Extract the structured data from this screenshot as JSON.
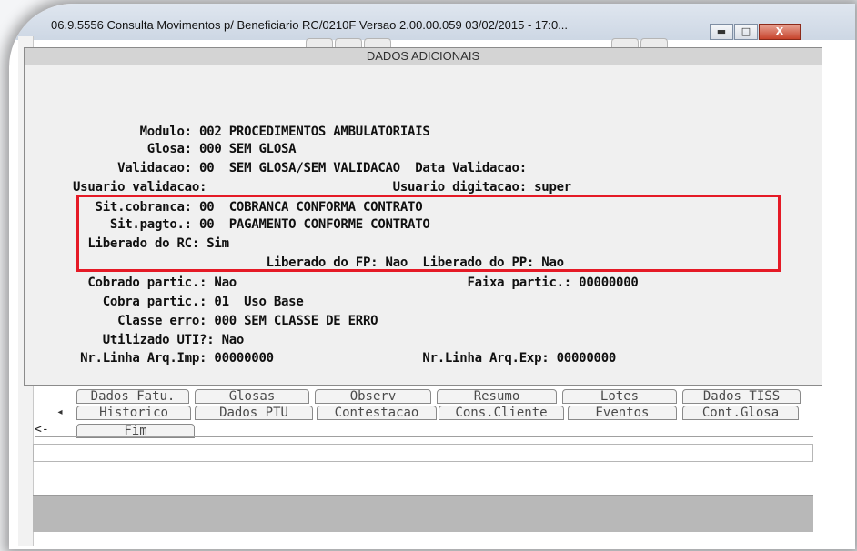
{
  "window": {
    "title": "06.9.5556 Consulta Movimentos p/ Beneficiario RC/0210F Versao 2.00.00.059 03/02/2015 - 17:0...",
    "minimize_glyph": "▬",
    "maximize_glyph": "□",
    "close_glyph": "X"
  },
  "dialog": {
    "title": "DADOS ADICIONAIS",
    "lines": [
      "         Modulo: 002 PROCEDIMENTOS AMBULATORIAIS",
      "          Glosa: 000 SEM GLOSA",
      "      Validacao: 00  SEM GLOSA/SEM VALIDACAO  Data Validacao:",
      "Usuario validacao:                         Usuario digitacao: super",
      "   Sit.cobranca: 00  COBRANCA CONFORMA CONTRATO",
      "     Sit.pagto.: 00  PAGAMENTO CONFORME CONTRATO",
      "  Liberado do RC: Sim",
      "                          Liberado do FP: Nao  Liberado do PP: Nao",
      "  Cobrado partic.: Nao                               Faixa partic.: 00000000",
      "    Cobra partic.: 01  Uso Base",
      "      Classe erro: 000 SEM CLASSE DE ERRO",
      "    Utilizado UTI?: Nao",
      " Nr.Linha Arq.Imp: 00000000                    Nr.Linha Arq.Exp: 00000000"
    ]
  },
  "tabs": {
    "row1": [
      "Dados Fatu.",
      "Glosas",
      "Observ",
      "Resumo",
      "Lotes",
      "Dados TISS"
    ],
    "row2": [
      "Historico",
      "Dados PTU",
      "Contestacao",
      "Cons.Cliente",
      "Eventos",
      "Cont.Glosa"
    ],
    "row3": [
      "Fim"
    ]
  },
  "nav": {
    "scroll_left_glyph": "◂",
    "back_arrow": "<-"
  },
  "colors": {
    "highlight_border": "#e51a26",
    "dialog_bg": "#f0f0f0",
    "status_bar": "#b8b8b8"
  }
}
